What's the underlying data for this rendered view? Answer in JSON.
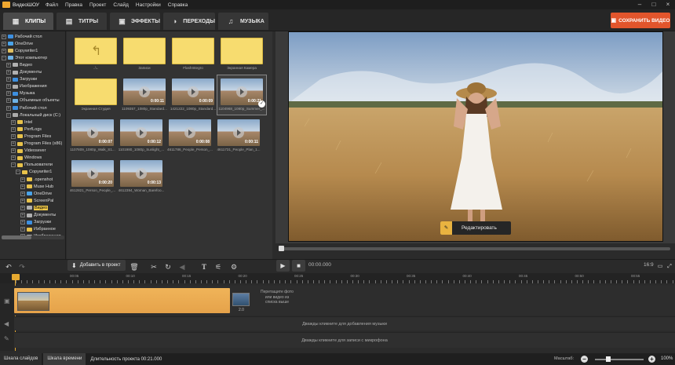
{
  "app": {
    "title": "ВидеоШОУ",
    "menu": [
      "Файл",
      "Правка",
      "Проект",
      "Слайд",
      "Настройки",
      "Справка"
    ]
  },
  "tabs": [
    {
      "label": "КЛИПЫ",
      "icon": "film-icon",
      "active": true
    },
    {
      "label": "ТИТРЫ",
      "icon": "text-box-icon",
      "active": false
    },
    {
      "label": "ЭФФЕКТЫ",
      "icon": "effects-icon",
      "active": false
    },
    {
      "label": "ПЕРЕХОДЫ",
      "icon": "transition-icon",
      "active": false
    },
    {
      "label": "МУЗЫКА",
      "icon": "music-icon",
      "active": false
    }
  ],
  "save_button": "СОХРАНИТЬ ВИДЕО",
  "tree": [
    {
      "label": "Рабочий стол",
      "color": "#3d8fe0"
    },
    {
      "label": "OneDrive",
      "color": "#4aa3e8"
    },
    {
      "label": "Copywriter1",
      "color": "#e0c060"
    },
    {
      "label": "Этот компьютер",
      "color": "#6fb3e6"
    },
    {
      "label": "Видео",
      "color": "#b0b0b0"
    },
    {
      "label": "Документы",
      "color": "#b0b0b0"
    },
    {
      "label": "Загрузки",
      "color": "#3d8fe0"
    },
    {
      "label": "Изображения",
      "color": "#b0b0b0"
    },
    {
      "label": "Музыка",
      "color": "#3d8fe0"
    },
    {
      "label": "Объемные объекты",
      "color": "#6fb3e6"
    },
    {
      "label": "Рабочий стол",
      "color": "#3d8fe0"
    },
    {
      "label": "Локальный диск (C:)",
      "color": "#aaaaaa"
    },
    {
      "label": "Intel",
      "color": "#e8c24a"
    },
    {
      "label": "PerfLogs",
      "color": "#e8c24a"
    },
    {
      "label": "Program Files",
      "color": "#e8c24a"
    },
    {
      "label": "Program Files (x86)",
      "color": "#e8c24a"
    },
    {
      "label": "Videosever",
      "color": "#e8c24a"
    },
    {
      "label": "Windows",
      "color": "#e8c24a"
    },
    {
      "label": "Пользователи",
      "color": "#e8c24a"
    },
    {
      "label": "Copywriter1",
      "color": "#e8c24a"
    },
    {
      "label": ".openshot",
      "color": "#e8c24a"
    },
    {
      "label": "Muse Hub",
      "color": "#e8c24a"
    },
    {
      "label": "OneDrive",
      "color": "#4aa3e8"
    },
    {
      "label": "ScreenPal",
      "color": "#e8c24a"
    },
    {
      "label": "Видео",
      "color": "#b0b0b0",
      "selected": true
    },
    {
      "label": "Документы",
      "color": "#b0b0b0"
    },
    {
      "label": "Загрузки",
      "color": "#3d8fe0"
    },
    {
      "label": "Избранное",
      "color": "#e8c24a"
    },
    {
      "label": "Изображения",
      "color": "#b0b0b0"
    }
  ],
  "library": [
    {
      "label": "..\\..",
      "type": "up"
    },
    {
      "label": "Записи",
      "type": "folder"
    },
    {
      "label": "FlashIntegro",
      "type": "folder"
    },
    {
      "label": "Экранная Камера",
      "type": "folder"
    },
    {
      "label": "Экранная Студия",
      "type": "folder"
    },
    {
      "label": "1109357_1080p_Standard...",
      "type": "video",
      "duration": "0:00:11"
    },
    {
      "label": "1421222_1080p_Standard...",
      "type": "video",
      "duration": "0:00:09"
    },
    {
      "label": "1104968_1080p_Summer_...",
      "type": "video",
      "duration": "0:00:21",
      "selected": true
    },
    {
      "label": "1107809_1080p_Walk_S1...",
      "type": "video",
      "duration": "0:00:07"
    },
    {
      "label": "1101980_1080p_Sunlight_...",
      "type": "video",
      "duration": "0:00:12"
    },
    {
      "label": "4611786_People_Person_...",
      "type": "video",
      "duration": "0:00:08"
    },
    {
      "label": "4611731_People_Plan_1...",
      "type": "video",
      "duration": "0:00:11"
    },
    {
      "label": "4612821_Person_People_...",
      "type": "video",
      "duration": "0:00:20"
    },
    {
      "label": "4612394_Woman_Barefoo...",
      "type": "video",
      "duration": "0:00:13"
    }
  ],
  "preview": {
    "edit_button": "Редактировать",
    "timecode": "00:00.000",
    "aspect_ratio": "16:9"
  },
  "toolbar": {
    "add_button": "Добавить в проект"
  },
  "ruler": [
    "00:05",
    "00:10",
    "00:15",
    "00:20",
    "00:25",
    "00:30",
    "00:35",
    "00:40",
    "00:45",
    "00:50",
    "00:55"
  ],
  "timeline": {
    "clip2_number": "2.0",
    "drop_hint": "Перетащите фото или видео из списка выше",
    "music_hint": "Дважды кликните для добавления музыки",
    "mic_hint": "Дважды кликните для записи с микрофона"
  },
  "statusbar": {
    "tab_slides": "Шкала слайдов",
    "tab_timeline": "Шкала времени",
    "duration": "Длительность проекта 00:21.000",
    "zoom_label": "Масштаб:",
    "zoom_value": "100%",
    "zoom_level_percent": 28
  },
  "colors": {
    "accent": "#e2552c",
    "timeline_clip": "#f0b459",
    "selection": "#f0c94a"
  }
}
